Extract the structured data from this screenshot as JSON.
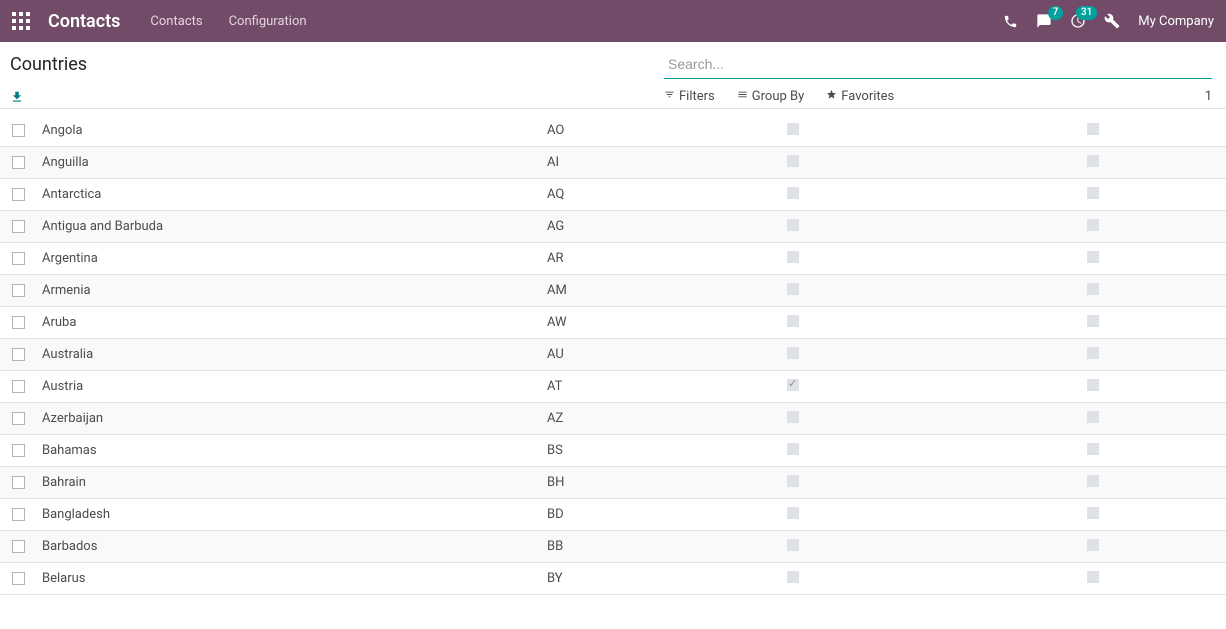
{
  "nav": {
    "brand": "Contacts",
    "links": [
      "Contacts",
      "Configuration"
    ],
    "badges": {
      "messages": "7",
      "activities": "31"
    },
    "company": "My Company"
  },
  "breadcrumb": "Countries",
  "search": {
    "placeholder": "Search..."
  },
  "search_options": {
    "filters": "Filters",
    "groupby": "Group By",
    "favorites": "Favorites"
  },
  "pager": "1",
  "rowsCount": 15,
  "rows": [
    {
      "name": "Angola",
      "code": "AO",
      "b1": false,
      "b2": false
    },
    {
      "name": "Anguilla",
      "code": "AI",
      "b1": false,
      "b2": false
    },
    {
      "name": "Antarctica",
      "code": "AQ",
      "b1": false,
      "b2": false
    },
    {
      "name": "Antigua and Barbuda",
      "code": "AG",
      "b1": false,
      "b2": false
    },
    {
      "name": "Argentina",
      "code": "AR",
      "b1": false,
      "b2": false
    },
    {
      "name": "Armenia",
      "code": "AM",
      "b1": false,
      "b2": false
    },
    {
      "name": "Aruba",
      "code": "AW",
      "b1": false,
      "b2": false
    },
    {
      "name": "Australia",
      "code": "AU",
      "b1": false,
      "b2": false
    },
    {
      "name": "Austria",
      "code": "AT",
      "b1": true,
      "b2": false
    },
    {
      "name": "Azerbaijan",
      "code": "AZ",
      "b1": false,
      "b2": false
    },
    {
      "name": "Bahamas",
      "code": "BS",
      "b1": false,
      "b2": false
    },
    {
      "name": "Bahrain",
      "code": "BH",
      "b1": false,
      "b2": false
    },
    {
      "name": "Bangladesh",
      "code": "BD",
      "b1": false,
      "b2": false
    },
    {
      "name": "Barbados",
      "code": "BB",
      "b1": false,
      "b2": false
    },
    {
      "name": "Belarus",
      "code": "BY",
      "b1": false,
      "b2": false
    }
  ]
}
